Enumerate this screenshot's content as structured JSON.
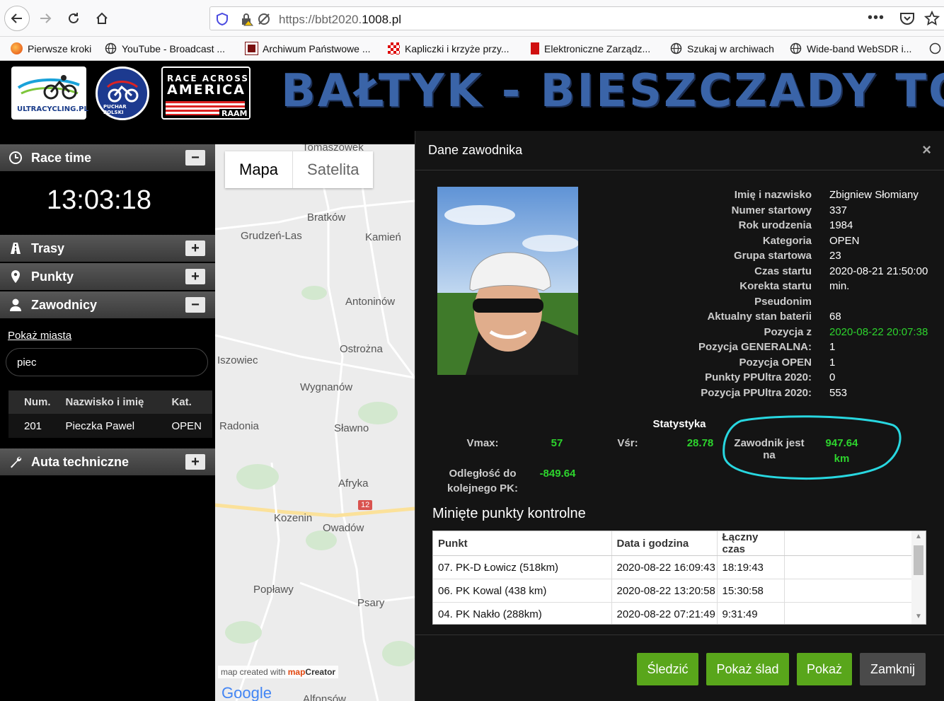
{
  "browser": {
    "url_prefix": "https://bbt2020.",
    "url_domain": "1008.pl"
  },
  "bookmarks": [
    {
      "label": "Pierwsze kroki",
      "icon": "firefox-icon"
    },
    {
      "label": "YouTube - Broadcast ...",
      "icon": "globe-icon"
    },
    {
      "label": "Archiwum Państwowe ...",
      "icon": "archive-icon"
    },
    {
      "label": "Kapliczki i krzyże przy...",
      "icon": "checker-icon"
    },
    {
      "label": "Elektroniczne Zarządz...",
      "icon": "doc-icon"
    },
    {
      "label": "Szukaj w archiwach",
      "icon": "globe-icon"
    },
    {
      "label": "Wide-band WebSDR i...",
      "icon": "globe-icon"
    }
  ],
  "banner": {
    "title": "BAŁTYK - BIESZCZADY TO",
    "logo1": "ULTRACYCLING.PL",
    "logo2": "PUCHAR POLSKI",
    "logo3_line1": "RACE ACROSS",
    "logo3_line2": "AMERICA",
    "logo3_sub": "RAAM"
  },
  "sidebar": {
    "race_time_label": "Race time",
    "race_time_value": "13:03:18",
    "routes_label": "Trasy",
    "points_label": "Punkty",
    "riders_label": "Zawodnicy",
    "show_cities": "Pokaż miasta",
    "search_value": "piec",
    "table_headers": [
      "Num.",
      "Nazwisko i imię",
      "Kat."
    ],
    "table_rows": [
      [
        "201",
        "Pieczka Pawel",
        "OPEN"
      ]
    ],
    "tech_cars_label": "Auta techniczne",
    "minus": "−",
    "plus": "+"
  },
  "map": {
    "tab_map": "Mapa",
    "tab_satellite": "Satelita",
    "credit_prefix": "map created with ",
    "credit_brand_a": "map",
    "credit_brand_b": "Creator",
    "google": "Google",
    "road_number": "12",
    "places": [
      "Tomaszówek",
      "Bratków",
      "Grudzeń-Las",
      "Kamień",
      "Antoninów",
      "Ostrożna",
      "Iszowiec",
      "Wygnanów",
      "Radonia",
      "Sławno",
      "Afryka",
      "Kozenin",
      "Owadów",
      "Popławy",
      "Psary",
      "Alfonsów"
    ]
  },
  "modal": {
    "title": "Dane zawodnika",
    "close": "×",
    "info": [
      {
        "label": "Imię i nazwisko",
        "value": "Zbigniew Słomiany"
      },
      {
        "label": "Numer startowy",
        "value": "337"
      },
      {
        "label": "Rok urodzenia",
        "value": "1984"
      },
      {
        "label": "Kategoria",
        "value": "OPEN"
      },
      {
        "label": "Grupa startowa",
        "value": "23"
      },
      {
        "label": "Czas startu",
        "value": "2020-08-21 21:50:00"
      },
      {
        "label": "Korekta startu",
        "value": "min."
      },
      {
        "label": "Pseudonim",
        "value": ""
      },
      {
        "label": "Aktualny stan baterii",
        "value": "68"
      },
      {
        "label": "Pozycja z",
        "value": "2020-08-22 20:07:38"
      },
      {
        "label": "Pozycja GENERALNA:",
        "value": "1"
      },
      {
        "label": "Pozycja OPEN",
        "value": "1"
      },
      {
        "label": "Punkty PPUltra 2020:",
        "value": "0"
      },
      {
        "label": "Pozycja PPUltra 2020:",
        "value": "553"
      }
    ],
    "stats": {
      "heading": "Statystyka",
      "vmax_label": "Vmax:",
      "vmax_value": "57",
      "vavg_label": "Vśr:",
      "vavg_value": "28.78",
      "position_label": "Zawodnik jest na",
      "position_value": "947.64",
      "position_unit": "km",
      "next_cp_label_1": "Odległość do",
      "next_cp_label_2": "kolejnego PK:",
      "next_cp_value": "-849.64"
    },
    "checkpoints": {
      "title": "Minięte punkty kontrolne",
      "headers": [
        "Punkt",
        "Data i godzina",
        "Łączny czas"
      ],
      "rows": [
        [
          "07. PK-D Łowicz (518km)",
          "2020-08-22 16:09:43",
          "18:19:43"
        ],
        [
          "06. PK Kowal (438 km)",
          "2020-08-22 13:20:58",
          "15:30:58"
        ],
        [
          "04. PK Nakło (288km)",
          "2020-08-22 07:21:49",
          "9:31:49"
        ]
      ]
    },
    "buttons": {
      "follow": "Śledzić",
      "show_track": "Pokaż ślad",
      "show": "Pokaż",
      "close": "Zamknij"
    }
  },
  "colors": {
    "green": "#2dd42d",
    "button_green": "#59a61b",
    "highlight_circle": "#28d7e0",
    "banner_blue": "#3a64a8"
  }
}
